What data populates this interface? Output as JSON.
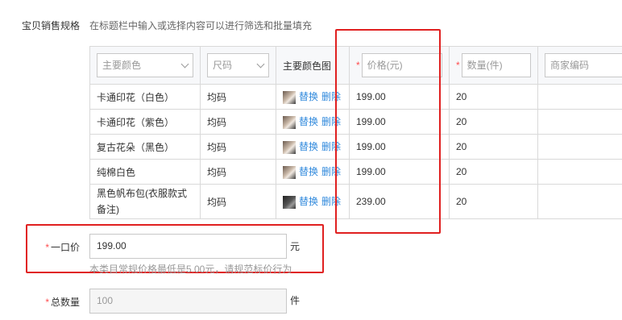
{
  "section": {
    "label": "宝贝销售规格",
    "hint": "在标题栏中输入或选择内容可以进行筛选和批量填充"
  },
  "table": {
    "headers": {
      "color_select_placeholder": "主要颜色",
      "size_select_placeholder": "尺码",
      "color_image": "主要颜色图",
      "price_placeholder": "价格(元)",
      "quantity_placeholder": "数量(件)",
      "merchant_code_placeholder": "商家编码",
      "required_mark": "*"
    },
    "rows": [
      {
        "color": "卡通印花（白色）",
        "size": "均码",
        "price": "199.00",
        "quantity": "20"
      },
      {
        "color": "卡通印花（紫色）",
        "size": "均码",
        "price": "199.00",
        "quantity": "20"
      },
      {
        "color": "复古花朵（黑色）",
        "size": "均码",
        "price": "199.00",
        "quantity": "20"
      },
      {
        "color": "纯棉白色",
        "size": "均码",
        "price": "199.00",
        "quantity": "20"
      },
      {
        "color": "黑色帆布包(衣服款式备注)",
        "size": "均码",
        "price": "239.00",
        "quantity": "20"
      }
    ],
    "actions": {
      "replace": "替换",
      "delete": "删除"
    }
  },
  "price_field": {
    "required_mark": "*",
    "label": "一口价",
    "value": "199.00",
    "unit": "元",
    "hint": "本类目常规价格最低是5.00元，请规范标价行为"
  },
  "total_quantity": {
    "required_mark": "*",
    "label": "总数量",
    "value": "100",
    "unit": "件"
  },
  "colors": {
    "link": "#3089dc",
    "required": "#ff4d4f",
    "highlight_box": "#e02020",
    "border": "#d9d9d9"
  }
}
